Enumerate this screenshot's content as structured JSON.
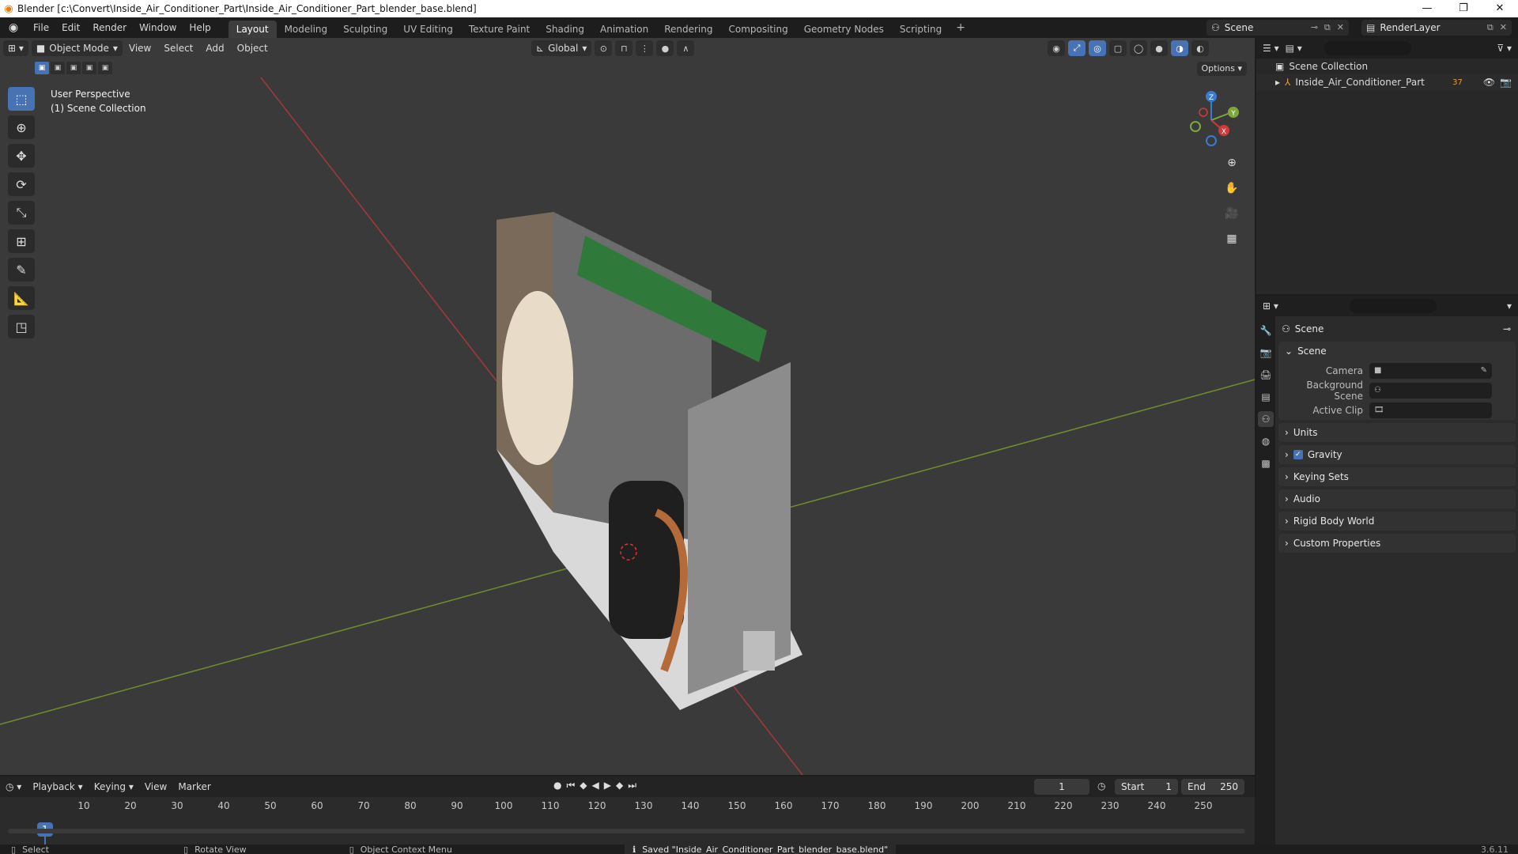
{
  "window": {
    "title": "Blender [c:\\Convert\\Inside_Air_Conditioner_Part\\Inside_Air_Conditioner_Part_blender_base.blend]"
  },
  "menu": [
    "File",
    "Edit",
    "Render",
    "Window",
    "Help"
  ],
  "workspaces": [
    "Layout",
    "Modeling",
    "Sculpting",
    "UV Editing",
    "Texture Paint",
    "Shading",
    "Animation",
    "Rendering",
    "Compositing",
    "Geometry Nodes",
    "Scripting"
  ],
  "active_workspace": "Layout",
  "scene_selector": "Scene",
  "layer_selector": "RenderLayer",
  "viewport": {
    "mode": "Object Mode",
    "menus": [
      "View",
      "Select",
      "Add",
      "Object"
    ],
    "orientation": "Global",
    "options": "Options",
    "info_line1": "User Perspective",
    "info_line2": "(1) Scene Collection",
    "gizmo": {
      "z": "Z",
      "y": "Y",
      "x": "X"
    }
  },
  "outliner": {
    "root": "Scene Collection",
    "child": "Inside_Air_Conditioner_Part",
    "child_count": "37"
  },
  "properties": {
    "context": "Scene",
    "scene_panel": "Scene",
    "fields": [
      {
        "label": "Camera"
      },
      {
        "label": "Background Scene"
      },
      {
        "label": "Active Clip"
      }
    ],
    "panels": [
      "Units",
      "Gravity",
      "Keying Sets",
      "Audio",
      "Rigid Body World",
      "Custom Properties"
    ]
  },
  "timeline": {
    "menus": [
      "Playback",
      "Keying",
      "View",
      "Marker"
    ],
    "current_frame": "1",
    "start_label": "Start",
    "start": "1",
    "end_label": "End",
    "end": "250",
    "ticks": [
      "1",
      "10",
      "20",
      "30",
      "40",
      "50",
      "60",
      "70",
      "80",
      "90",
      "100",
      "110",
      "120",
      "130",
      "140",
      "150",
      "160",
      "170",
      "180",
      "190",
      "200",
      "210",
      "220",
      "230",
      "240",
      "250"
    ]
  },
  "statusbar": {
    "select": "Select",
    "rotate": "Rotate View",
    "context_menu": "Object Context Menu",
    "message": "Saved \"Inside_Air_Conditioner_Part_blender_base.blend\"",
    "version": "3.6.11"
  },
  "colors": {
    "accent": "#4772b3",
    "x_axis": "#d13a3a",
    "y_axis": "#7ca83a",
    "z_axis": "#3a7bd1",
    "viewport_bg": "#3a3a3a"
  }
}
